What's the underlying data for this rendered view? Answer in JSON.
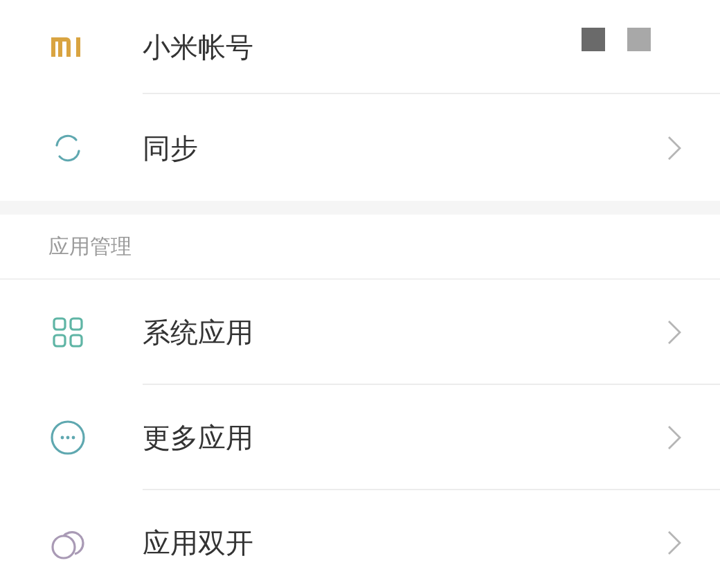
{
  "account_group": [
    {
      "kind": "account",
      "label": "小米帐号"
    },
    {
      "kind": "link",
      "label": "同步"
    }
  ],
  "sections": [
    {
      "header": "应用管理",
      "items": [
        {
          "kind": "link",
          "label": "系统应用"
        },
        {
          "kind": "link",
          "label": "更多应用"
        },
        {
          "kind": "link",
          "label": "应用双开"
        }
      ]
    }
  ]
}
